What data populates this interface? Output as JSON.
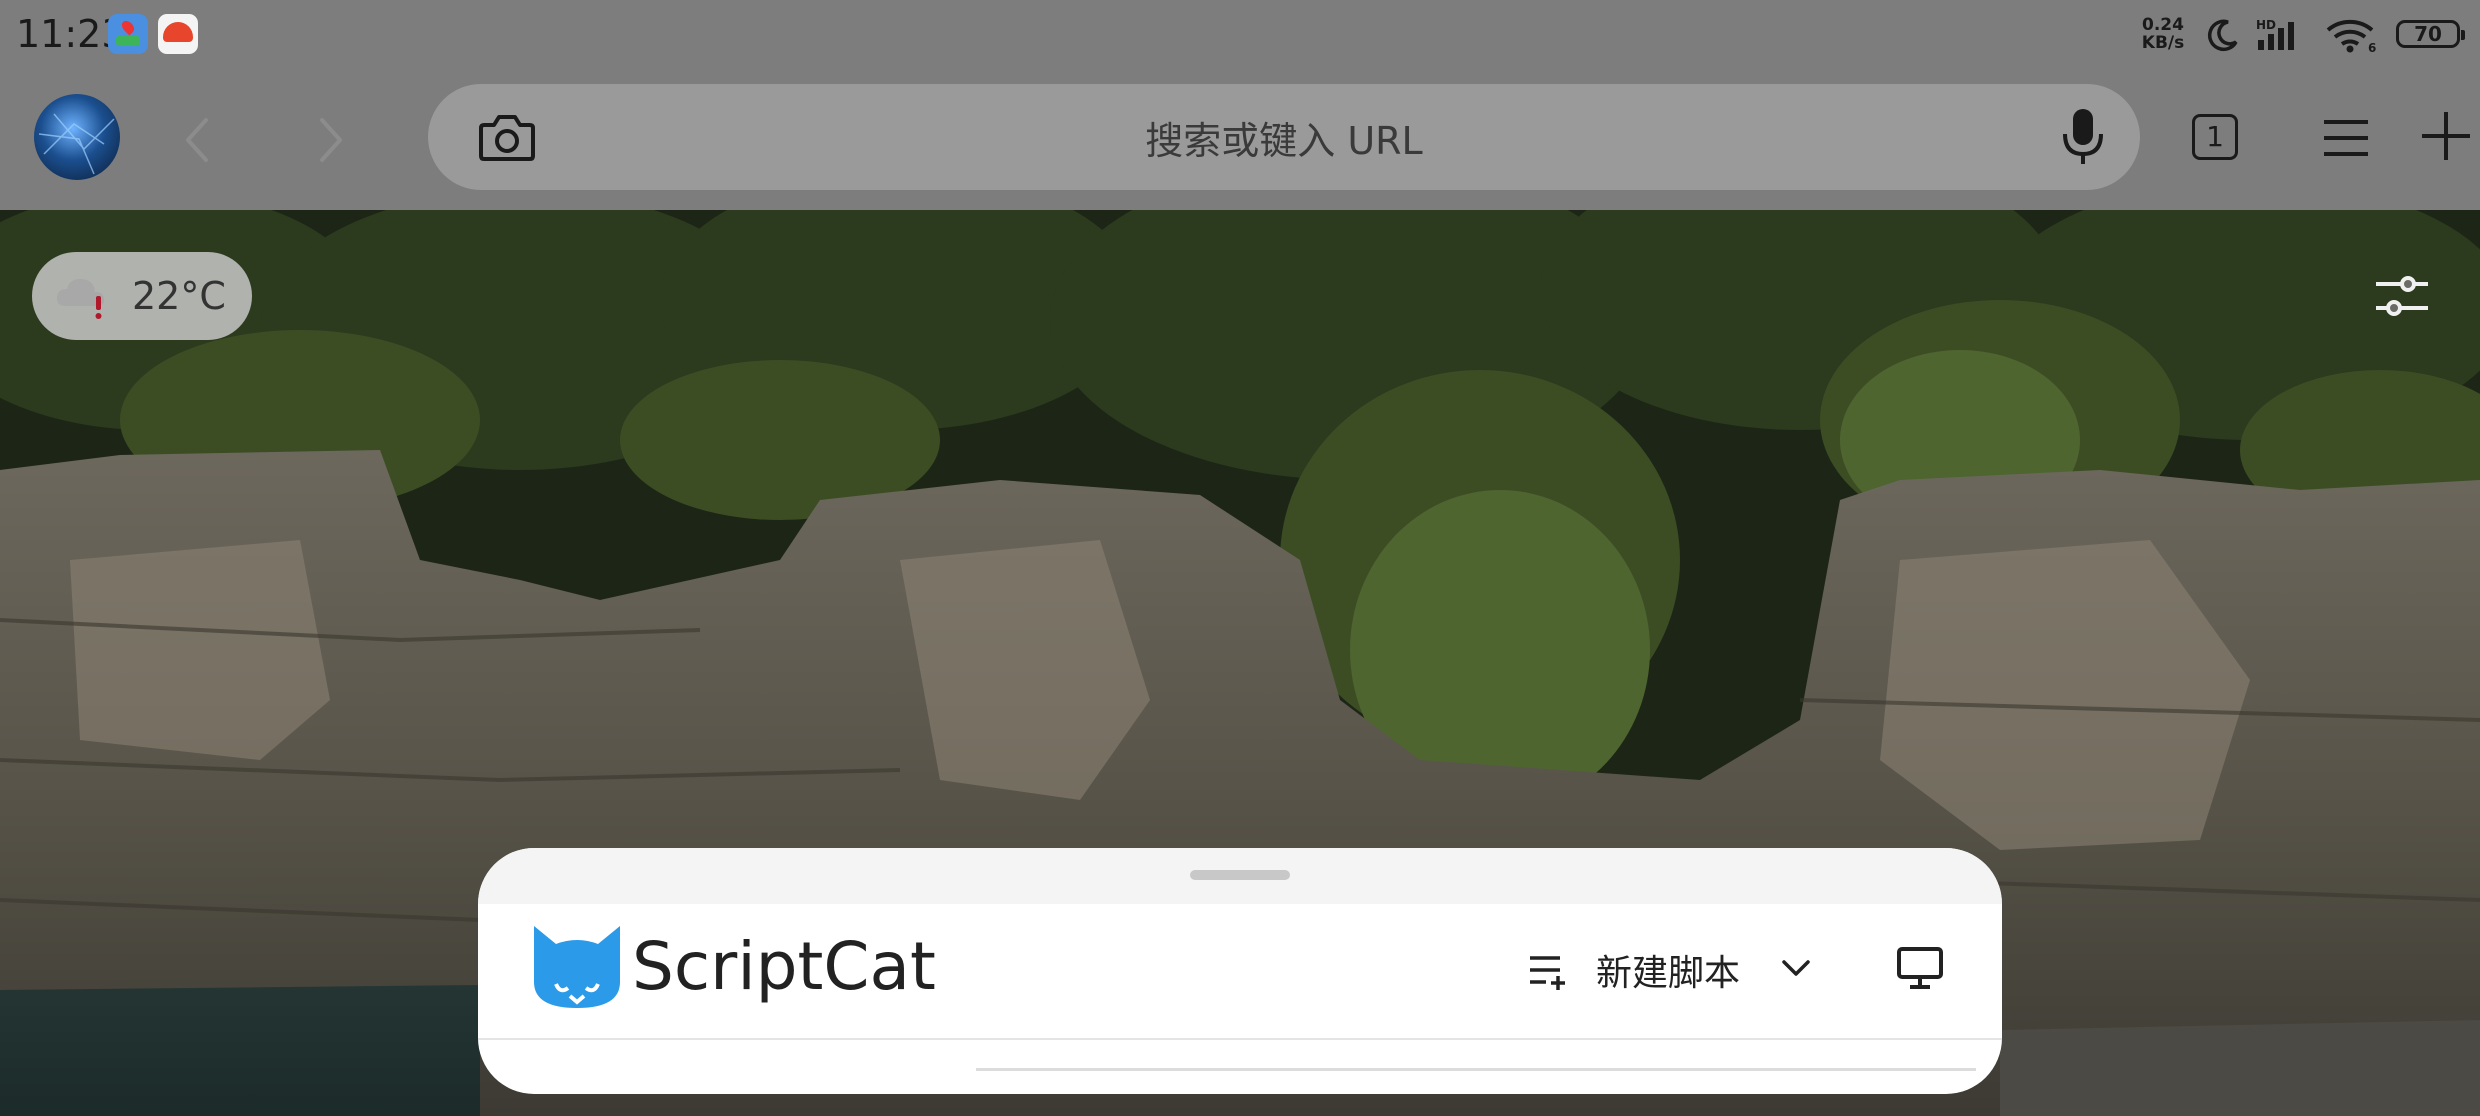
{
  "status_bar": {
    "time": "11:23",
    "apps": [
      "maps-icon",
      "game-icon"
    ],
    "net_speed_value": "0.24",
    "net_speed_unit": "KB/s",
    "signal_label": "HD",
    "wifi_label": "6",
    "battery": "70"
  },
  "toolbar": {
    "url_placeholder": "搜索或键入 URL",
    "tab_count": "1",
    "icons": [
      "avatar",
      "chevron-left-icon",
      "chevron-right-icon",
      "camera-icon",
      "mic-icon",
      "tabs-icon",
      "menu-icon",
      "plus-icon"
    ]
  },
  "weather": {
    "temperature": "22°C",
    "icon": "cloud-alert-icon"
  },
  "panel": {
    "brand": "ScriptCat",
    "new_script_label": "新建脚本",
    "icons": [
      "scriptcat-logo-icon",
      "list-add-icon",
      "chevron-down-icon",
      "desktop-icon"
    ]
  },
  "colors": {
    "status_bar_bg": "#7d7d7d",
    "urlbar_bg": "#9a9a9a",
    "brand_blue": "#2b9ae8",
    "panel_bg": "#ffffff"
  }
}
